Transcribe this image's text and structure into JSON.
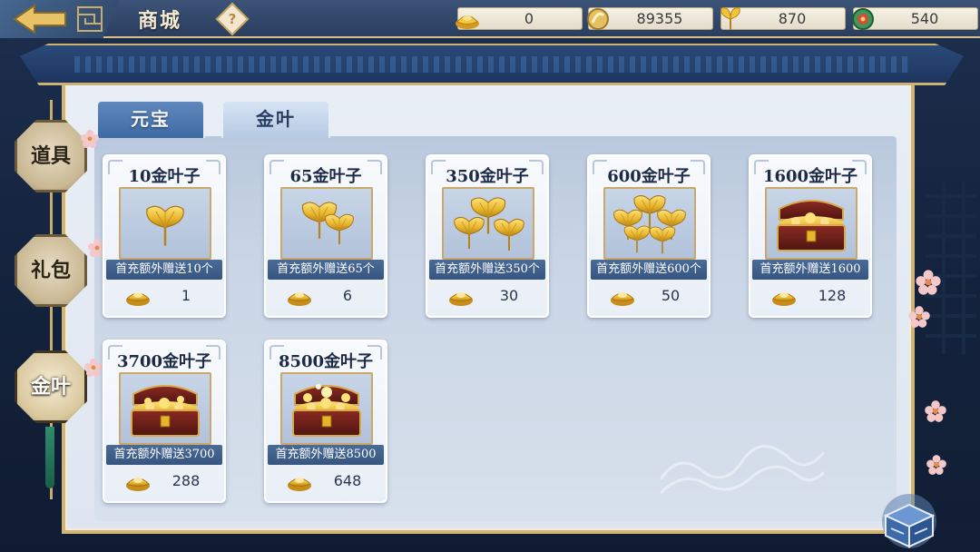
{
  "header": {
    "title": "商城",
    "help_label": "?"
  },
  "currencies": [
    {
      "name": "yuanbao-ingot",
      "value": "0"
    },
    {
      "name": "gold-coin",
      "value": "89355"
    },
    {
      "name": "gold-leaf",
      "value": "870"
    },
    {
      "name": "jade-token",
      "value": "540"
    }
  ],
  "tabs": [
    {
      "label": "元宝",
      "active": false
    },
    {
      "label": "金叶",
      "active": true
    }
  ],
  "side_categories": [
    {
      "label": "道具",
      "active": false
    },
    {
      "label": "礼包",
      "active": false
    },
    {
      "label": "金叶",
      "active": true
    }
  ],
  "products": [
    {
      "title": "10金叶子",
      "bonus": "首充额外赠送10个",
      "price": "1",
      "image": "ginkgo-leaf-small"
    },
    {
      "title": "65金叶子",
      "bonus": "首充额外赠送65个",
      "price": "6",
      "image": "ginkgo-leaf-double"
    },
    {
      "title": "350金叶子",
      "bonus": "首充额外赠送350个",
      "price": "30",
      "image": "ginkgo-leaf-triple"
    },
    {
      "title": "600金叶子",
      "bonus": "首充额外赠送600个",
      "price": "50",
      "image": "ginkgo-leaf-bunch"
    },
    {
      "title": "1600金叶子",
      "bonus": "首充额外赠送1600",
      "price": "128",
      "image": "treasure-chest-small"
    },
    {
      "title": "3700金叶子",
      "bonus": "首充额外赠送3700",
      "price": "288",
      "image": "treasure-chest-medium"
    },
    {
      "title": "8500金叶子",
      "bonus": "首充额外赠送8500",
      "price": "648",
      "image": "treasure-chest-large"
    }
  ],
  "colors": {
    "gold": "#e7b52a",
    "gold_dark": "#b7831a",
    "bonus_bar": "#3f608c",
    "panel_bg": "#dfe6f1",
    "frame_gold": "#cfb57a"
  }
}
